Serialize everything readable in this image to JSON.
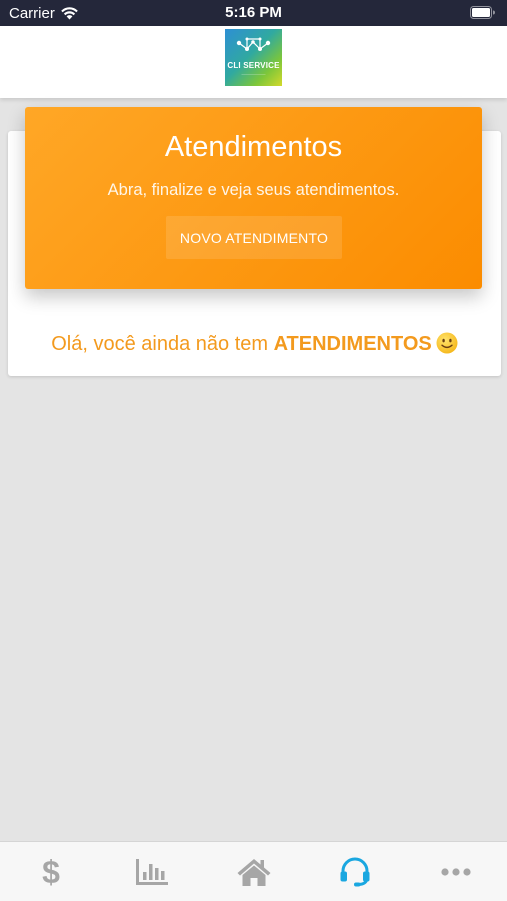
{
  "status_bar": {
    "carrier": "Carrier",
    "time": "5:16 PM"
  },
  "header": {
    "logo_text": "CLI SERVICE",
    "logo_icon": "network-logo"
  },
  "banner": {
    "title": "Atendimentos",
    "subtitle": "Abra, finalize e veja seus atendimentos.",
    "button_label": "NOVO ATENDIMENTO"
  },
  "empty_state": {
    "prefix": "Olá, você ainda não tem ",
    "highlight": "ATENDIMENTOS",
    "emoji": "slightly-smiling-face"
  },
  "tab_bar": {
    "active_tab": "atendimentos",
    "tabs": [
      {
        "id": "financeiro",
        "icon": "dollar-icon"
      },
      {
        "id": "relatorios",
        "icon": "bar-chart-icon"
      },
      {
        "id": "inicio",
        "icon": "home-icon"
      },
      {
        "id": "atendimentos",
        "icon": "headset-icon"
      },
      {
        "id": "mais",
        "icon": "more-icon"
      }
    ]
  },
  "colors": {
    "status_bar": "#24273a",
    "accent_orange": "#fb8c00",
    "message_orange": "#f39a1e",
    "active_tab": "#1aa7e0",
    "inactive_tab": "#a6a6a6",
    "background": "#e4e4e4"
  }
}
